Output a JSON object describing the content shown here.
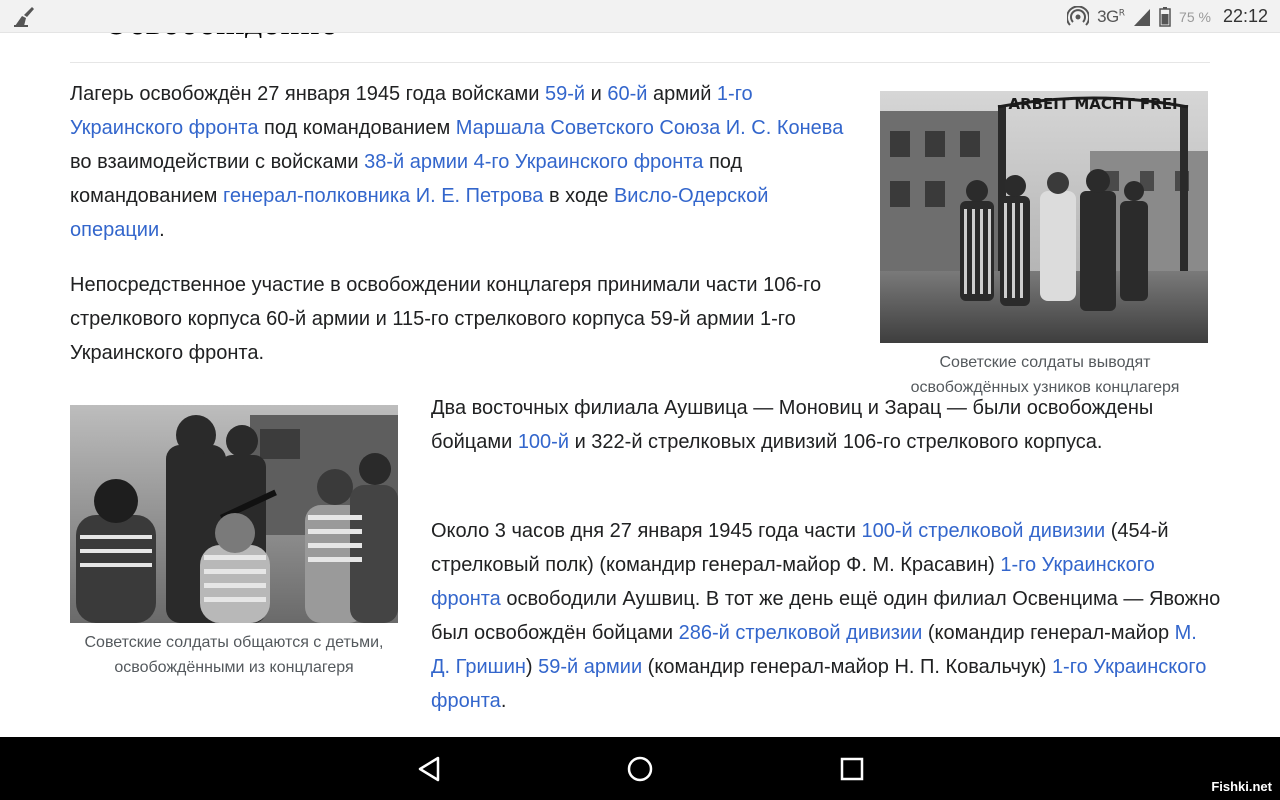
{
  "statusbar": {
    "network_label": "3G",
    "network_badge": "R",
    "battery_percent": "75 %",
    "time": "22:12"
  },
  "article": {
    "heading_partial": "Освобождение",
    "p1": [
      {
        "t": "Лагерь освобождён 27 января 1945 года войсками "
      },
      {
        "t": "59-й",
        "link": true
      },
      {
        "t": " и "
      },
      {
        "t": "60-й",
        "link": true
      },
      {
        "t": " армий "
      },
      {
        "t": "1-го Украинского фронта",
        "link": true
      },
      {
        "t": " под командованием "
      },
      {
        "t": "Маршала Советского Союза И. С. Конева",
        "link": true
      },
      {
        "t": " во взаимодействии с войсками "
      },
      {
        "t": "38-й армии 4-го Украинского фронта",
        "link": true
      },
      {
        "t": " под командованием "
      },
      {
        "t": "генерал-полковника И. Е. Петрова",
        "link": true
      },
      {
        "t": " в ходе "
      },
      {
        "t": "Висло-Одерской операции",
        "link": true
      },
      {
        "t": "."
      }
    ],
    "p2": [
      {
        "t": "Непосредственное участие в освобождении концлагеря принимали части 106-го стрелкового корпуса 60-й армии и 115-го стрелкового корпуса 59-й армии 1-го Украинского фронта."
      }
    ],
    "p3": [
      {
        "t": "Два восточных филиала Аушвица — Моновиц и Зарац — были освобождены бойцами "
      },
      {
        "t": "100-й",
        "link": true
      },
      {
        "t": " и 322-й стрелковых дивизий 106-го стрелкового корпуса."
      }
    ],
    "p4": [
      {
        "t": "Около 3 часов дня 27 января 1945 года части "
      },
      {
        "t": "100-й стрелковой дивизии",
        "link": true
      },
      {
        "t": " (454-й стрелковый полк) (командир генерал-майор Ф. М. Красавин) "
      },
      {
        "t": "1-го Украинского фронта",
        "link": true
      },
      {
        "t": " освободили Аушвиц. В тот же день ещё один филиал Освенцима — Явожно был освобождён бойцами "
      },
      {
        "t": "286-й стрелковой дивизии",
        "link": true
      },
      {
        "t": " (командир генерал-майор "
      },
      {
        "t": "М. Д. Гришин",
        "link": true
      },
      {
        "t": ") "
      },
      {
        "t": "59-й армии",
        "link": true
      },
      {
        "t": " (командир генерал-майор Н. П. Ковальчук) "
      },
      {
        "t": "1-го Украинского фронта",
        "link": true
      },
      {
        "t": "."
      }
    ],
    "figure1": {
      "gate_sign": "ARBEIT MACHT FREI",
      "caption": "Советские солдаты выводят освобождённых узников концлагеря"
    },
    "figure2": {
      "caption": "Советские солдаты общаются с детьми, освобождёнными из концлагеря"
    }
  },
  "colors": {
    "link": "#3366cc",
    "text": "#202122",
    "caption": "#54595d"
  },
  "navbar": {
    "watermark": "Fishki.net"
  }
}
